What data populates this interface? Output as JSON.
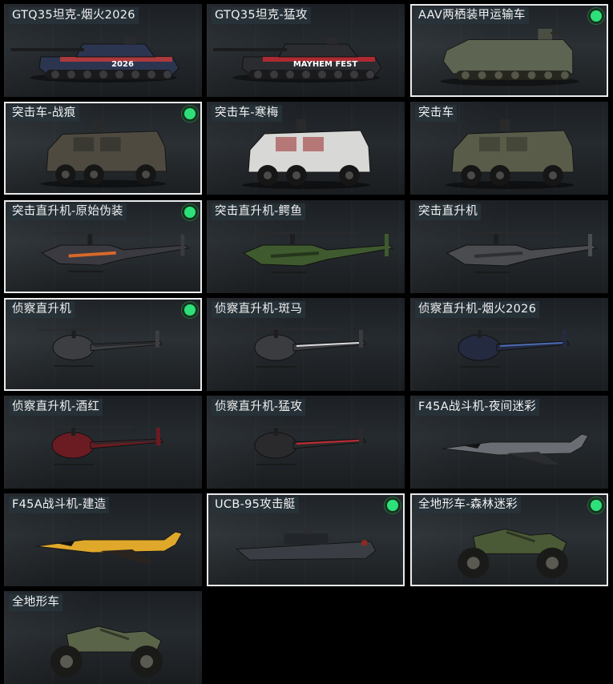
{
  "vehicles": [
    {
      "label": "GTQ35坦克-烟火2026",
      "selected": false,
      "equipped": false,
      "kind": "tank",
      "body_color": "#2c3550",
      "accent_color": "#c23a3a",
      "badge_text": "2026"
    },
    {
      "label": "GTQ35坦克-猛攻",
      "selected": false,
      "equipped": false,
      "kind": "tank",
      "body_color": "#2a2c30",
      "accent_color": "#c42a32",
      "badge_text": "MAYHEM FEST"
    },
    {
      "label": "AAV两栖装甲运输车",
      "selected": true,
      "equipped": true,
      "kind": "amphib",
      "body_color": "#5e6452",
      "accent_color": "#4a4e42",
      "badge_text": ""
    },
    {
      "label": "突击车-战痕",
      "selected": true,
      "equipped": true,
      "kind": "mrap",
      "body_color": "#4e4a40",
      "accent_color": "#2a2a26",
      "badge_text": ""
    },
    {
      "label": "突击车-寒梅",
      "selected": false,
      "equipped": false,
      "kind": "mrap",
      "body_color": "#d8d8d6",
      "accent_color": "#9a2a2a",
      "badge_text": ""
    },
    {
      "label": "突击车",
      "selected": false,
      "equipped": false,
      "kind": "mrap",
      "body_color": "#5a5c4a",
      "accent_color": "#35372c",
      "badge_text": ""
    },
    {
      "label": "突击直升机-原始伪装",
      "selected": true,
      "equipped": true,
      "kind": "attack-heli",
      "body_color": "#3a3a40",
      "accent_color": "#d8682a",
      "badge_text": ""
    },
    {
      "label": "突击直升机-鳄鱼",
      "selected": false,
      "equipped": false,
      "kind": "attack-heli",
      "body_color": "#3e5a2e",
      "accent_color": "#26361c",
      "badge_text": ""
    },
    {
      "label": "突击直升机",
      "selected": false,
      "equipped": false,
      "kind": "attack-heli",
      "body_color": "#4a4c50",
      "accent_color": "#2e3034",
      "badge_text": ""
    },
    {
      "label": "侦察直升机",
      "selected": true,
      "equipped": true,
      "kind": "scout-heli",
      "body_color": "#3c3e42",
      "accent_color": "#25272a",
      "badge_text": ""
    },
    {
      "label": "侦察直升机-斑马",
      "selected": false,
      "equipped": false,
      "kind": "scout-heli",
      "body_color": "#3a3c40",
      "accent_color": "#d8dadc",
      "badge_text": ""
    },
    {
      "label": "侦察直升机-烟火2026",
      "selected": false,
      "equipped": false,
      "kind": "scout-heli",
      "body_color": "#242a40",
      "accent_color": "#4a6ab0",
      "badge_text": ""
    },
    {
      "label": "侦察直升机-酒红",
      "selected": false,
      "equipped": false,
      "kind": "scout-heli",
      "body_color": "#6a1c22",
      "accent_color": "#2a2a2c",
      "badge_text": ""
    },
    {
      "label": "侦察直升机-猛攻",
      "selected": false,
      "equipped": false,
      "kind": "scout-heli",
      "body_color": "#2a2a2c",
      "accent_color": "#c42a32",
      "badge_text": ""
    },
    {
      "label": "F45A战斗机-夜间迷彩",
      "selected": false,
      "equipped": false,
      "kind": "jet",
      "body_color": "#6a6e74",
      "accent_color": "#2a2c30",
      "badge_text": ""
    },
    {
      "label": "F45A战斗机-建造",
      "selected": false,
      "equipped": false,
      "kind": "jet",
      "body_color": "#e0a82a",
      "accent_color": "#2a2420",
      "badge_text": ""
    },
    {
      "label": "UCB-95攻击艇",
      "selected": true,
      "equipped": true,
      "kind": "boat",
      "body_color": "#3a3e44",
      "accent_color": "#22252a",
      "badge_text": ""
    },
    {
      "label": "全地形车-森林迷彩",
      "selected": true,
      "equipped": true,
      "kind": "atv",
      "body_color": "#4a5a36",
      "accent_color": "#2e3422",
      "badge_text": ""
    },
    {
      "label": "全地形车",
      "selected": false,
      "equipped": false,
      "kind": "atv",
      "body_color": "#5a6448",
      "accent_color": "#33382a",
      "badge_text": ""
    }
  ],
  "icons": {
    "equipped": "green-dot-icon"
  },
  "colors": {
    "page_background": "#000000",
    "card_background": "#22272b",
    "selected_border": "#e8eaec",
    "equipped_dot": "#2ee07a",
    "label_text": "#f2f2f2"
  }
}
